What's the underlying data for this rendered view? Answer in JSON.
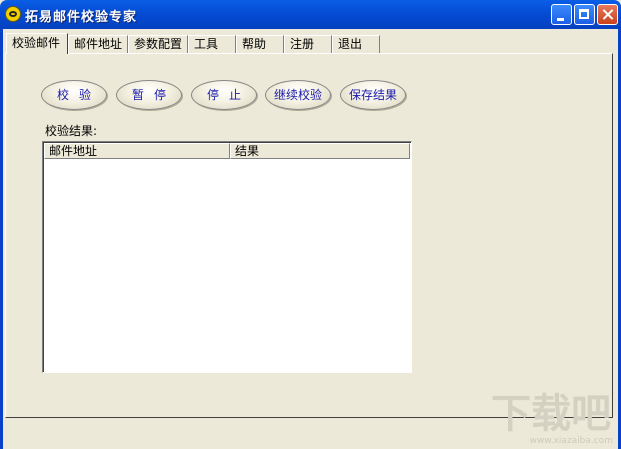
{
  "window": {
    "title": "拓易邮件校验专家",
    "controls": [
      "minimize",
      "maximize",
      "close"
    ]
  },
  "tabs": [
    {
      "label": "校验邮件",
      "active": true
    },
    {
      "label": "邮件地址",
      "active": false
    },
    {
      "label": "参数配置",
      "active": false
    },
    {
      "label": "工具",
      "active": false
    },
    {
      "label": "帮助",
      "active": false
    },
    {
      "label": "注册",
      "active": false
    },
    {
      "label": "退出",
      "active": false
    }
  ],
  "toolbar": {
    "verify_label": "校验",
    "pause_label": "暂停",
    "stop_label": "停止",
    "continue_label": "继续校验",
    "save_label": "保存结果"
  },
  "results": {
    "label": "校验结果:",
    "columns": [
      "邮件地址",
      "结果"
    ],
    "rows": []
  },
  "watermark": {
    "text": "下载吧",
    "url": "www.xiazaiba.com"
  },
  "colors": {
    "titlebar": "#0a5ee6",
    "window_bg": "#ece9d8",
    "button_text": "#1a1aa8",
    "close_button": "#c9421b"
  }
}
